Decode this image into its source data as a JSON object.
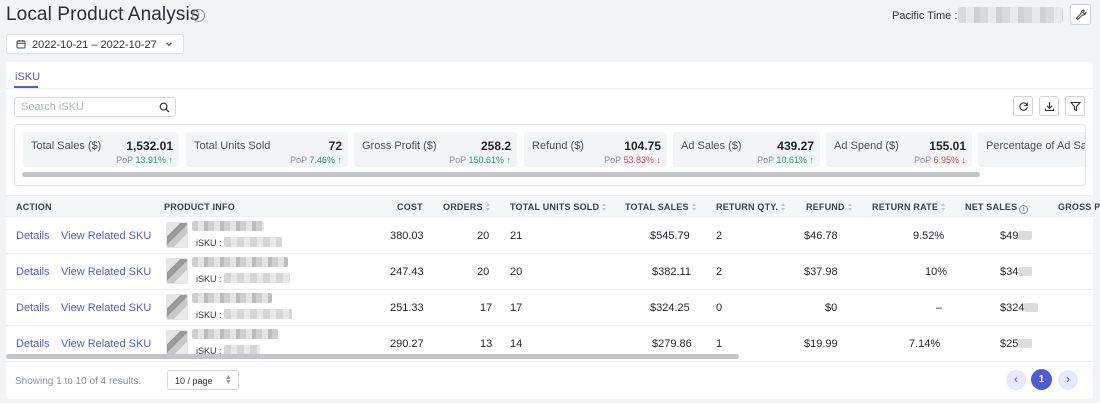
{
  "header": {
    "title": "Local Product Analysis",
    "timezone_label": "Pacific Time :"
  },
  "date_range": "2022-10-21 – 2022-10-27",
  "tabs": [
    {
      "label": "iSKU",
      "active": true
    }
  ],
  "search": {
    "placeholder": "Search iSKU"
  },
  "metrics": [
    {
      "label": "Total Sales ($)",
      "value": "1,532.01",
      "pop_label": "PoP",
      "pop": "13.91%",
      "trend": "up"
    },
    {
      "label": "Total Units Sold",
      "value": "72",
      "pop_label": "PoP",
      "pop": "7.46%",
      "trend": "up"
    },
    {
      "label": "Gross Profit ($)",
      "value": "258.2",
      "pop_label": "PoP",
      "pop": "150.61%",
      "trend": "up"
    },
    {
      "label": "Refund ($)",
      "value": "104.75",
      "pop_label": "PoP",
      "pop": "53.83%",
      "trend": "down"
    },
    {
      "label": "Ad Sales ($)",
      "value": "439.27",
      "pop_label": "PoP",
      "pop": "10.61%",
      "trend": "up"
    },
    {
      "label": "Ad Spend ($)",
      "value": "155.01",
      "pop_label": "PoP",
      "pop": "6.95%",
      "trend": "down"
    },
    {
      "label": "Percentage of Ad Sa",
      "value": "",
      "pop_label": "",
      "pop": "",
      "trend": ""
    }
  ],
  "table": {
    "columns": [
      "ACTION",
      "PRODUCT INFO",
      "COST",
      "ORDERS",
      "TOTAL UNITS SOLD",
      "TOTAL SALES",
      "RETURN QTY.",
      "REFUND",
      "RETURN RATE",
      "NET SALES",
      "GROSS P"
    ],
    "action_details": "Details",
    "action_related": "View Related SKU",
    "isku_label": "iSKU :",
    "rows": [
      {
        "cost": "380.03",
        "orders": "20",
        "units": "21",
        "sales": "$545.79",
        "return_qty": "2",
        "refund": "$46.78",
        "return_rate": "9.52%",
        "net_sales": "$49"
      },
      {
        "cost": "247.43",
        "orders": "20",
        "units": "20",
        "sales": "$382.11",
        "return_qty": "2",
        "refund": "$37.98",
        "return_rate": "10%",
        "net_sales": "$34"
      },
      {
        "cost": "251.33",
        "orders": "17",
        "units": "17",
        "sales": "$324.25",
        "return_qty": "0",
        "refund": "$0",
        "return_rate": "–",
        "net_sales": "$324"
      },
      {
        "cost": "290.27",
        "orders": "13",
        "units": "14",
        "sales": "$279.86",
        "return_qty": "1",
        "refund": "$19.99",
        "return_rate": "7.14%",
        "net_sales": "$25"
      }
    ]
  },
  "footer": {
    "showing": "Showing 1 to 10 of 4 results.",
    "page_size": "10 / page",
    "current_page": "1"
  },
  "colors": {
    "accent": "#4e5bd6",
    "up": "#1aa56b",
    "down": "#e04848"
  }
}
